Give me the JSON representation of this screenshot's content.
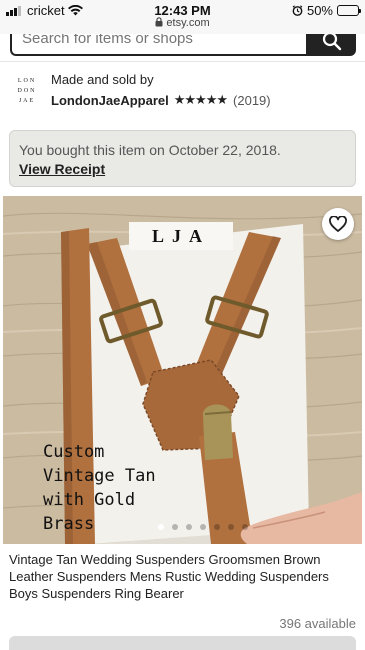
{
  "status_bar": {
    "carrier": "cricket",
    "time": "12:43 PM",
    "url": "etsy.com",
    "battery": "50%",
    "battery_level": 0.5
  },
  "search": {
    "placeholder": "Search for items or shops"
  },
  "shop": {
    "logo_lines": [
      "LON",
      "DON",
      "JAE"
    ],
    "made_by_label": "Made and sold by",
    "name": "LondonJaeApparel",
    "stars": "★★★★★",
    "rating": 5,
    "review_count": "(2019)"
  },
  "purchase_notice": {
    "text": "You bought this item on October 22, 2018.",
    "link": "View Receipt"
  },
  "product": {
    "tag_brand": "LJA",
    "image_text": "Custom\nVintage Tan\nwith Gold\nBrass",
    "carousel_count": 7,
    "carousel_active": 0,
    "title": "Vintage Tan Wedding Suspenders Groomsmen Brown Leather Suspenders Mens Rustic Wedding Suspenders Boys Suspenders Ring Bearer",
    "availability": "396 available"
  },
  "colors": {
    "leather": "#b0713f",
    "leather_dark": "#8a5530",
    "wood": "#c9b89d",
    "brass": "#a89458",
    "notice_bg": "#e9eae6"
  },
  "icons": {
    "search": "search-icon",
    "favorite": "heart-outline-icon",
    "wifi": "wifi-icon",
    "lock": "lock-icon",
    "alarm": "alarm-icon"
  }
}
